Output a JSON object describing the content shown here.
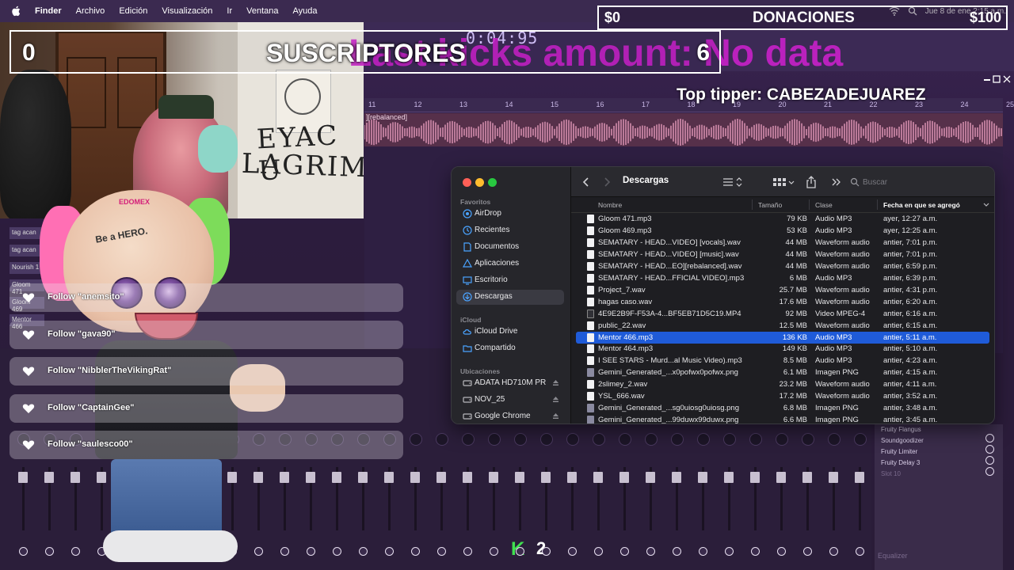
{
  "menubar": {
    "app": "Finder",
    "items": [
      "Archivo",
      "Edición",
      "Visualización",
      "Ir",
      "Ventana",
      "Ayuda"
    ],
    "clock": "Jue 8 de ene  2:15 a.m."
  },
  "daw": {
    "time": "0:04:95",
    "ruler": [
      "11",
      "12",
      "13",
      "14",
      "15",
      "16",
      "17",
      "18",
      "19",
      "20",
      "21",
      "22",
      "23",
      "24",
      "25"
    ],
    "clip_label": "][rebalanced]",
    "left_tags": [
      "tag acan",
      "tag acan",
      "Nourish 1",
      "Gloom 471",
      "Gloom 469",
      "Mentor 466"
    ],
    "fx_items": [
      "Fruity Flangus",
      "Soundgoodizer",
      "Fruity Limiter",
      "Fruity Delay 3",
      "Slot 10"
    ],
    "equalizer": "Equalizer",
    "k2_number": "2"
  },
  "webcam": {
    "graffiti_line1": "EYAC U",
    "graffiti_line2": "LAGRIMA"
  },
  "avatar": {
    "brand": "EDOMEX",
    "hero": "Be a HERO."
  },
  "subs": {
    "count": "0",
    "label": "SUSCRIPTORES",
    "goal": "6",
    "kicks_text": "Last kicks amount: No data"
  },
  "donations": {
    "min": "$0",
    "label": "DONACIONES",
    "max": "$100",
    "top_tipper": "Top tipper: CABEZADEJUAREZ"
  },
  "follows": [
    {
      "text": "Follow \"anemsito\""
    },
    {
      "text": "Follow \"gava90\""
    },
    {
      "text": "Follow \"NibblerTheVikingRat\""
    },
    {
      "text": "Follow \"CaptainGee\""
    },
    {
      "text": "Follow \"saulesco00\""
    }
  ],
  "finder": {
    "title": "Descargas",
    "search_placeholder": "Buscar",
    "sidebar": {
      "favorites_header": "Favoritos",
      "favorites": [
        {
          "label": "AirDrop",
          "icon": "airdrop-icon"
        },
        {
          "label": "Recientes",
          "icon": "clock-icon"
        },
        {
          "label": "Documentos",
          "icon": "document-icon"
        },
        {
          "label": "Aplicaciones",
          "icon": "applications-icon"
        },
        {
          "label": "Escritorio",
          "icon": "desktop-icon"
        },
        {
          "label": "Descargas",
          "icon": "download-icon"
        }
      ],
      "icloud_header": "iCloud",
      "icloud": [
        {
          "label": "iCloud Drive",
          "icon": "cloud-icon"
        },
        {
          "label": "Compartido",
          "icon": "shared-folder-icon"
        }
      ],
      "locations_header": "Ubicaciones",
      "locations": [
        {
          "label": "ADATA HD710M PR",
          "icon": "drive-icon"
        },
        {
          "label": "NOV_25",
          "icon": "drive-icon"
        },
        {
          "label": "Google Chrome",
          "icon": "drive-icon"
        }
      ]
    },
    "columns": {
      "name": "Nombre",
      "size": "Tamaño",
      "kind": "Clase",
      "date": "Fecha en que se agregó"
    },
    "files": [
      {
        "name": "Gloom 471.mp3",
        "size": "79 KB",
        "kind": "Audio MP3",
        "date": "ayer, 12:27 a.m.",
        "type": "doc"
      },
      {
        "name": "Gloom 469.mp3",
        "size": "53 KB",
        "kind": "Audio MP3",
        "date": "ayer, 12:25 a.m.",
        "type": "doc"
      },
      {
        "name": "SEMATARY - HEAD...VIDEO] [vocals].wav",
        "size": "44 MB",
        "kind": "Waveform audio",
        "date": "antier, 7:01 p.m.",
        "type": "doc"
      },
      {
        "name": "SEMATARY - HEAD...VIDEO] [music].wav",
        "size": "44 MB",
        "kind": "Waveform audio",
        "date": "antier, 7:01 p.m.",
        "type": "doc"
      },
      {
        "name": "SEMATARY - HEAD...EO][rebalanced].wav",
        "size": "44 MB",
        "kind": "Waveform audio",
        "date": "antier, 6:59 p.m.",
        "type": "doc"
      },
      {
        "name": "SEMATARY - HEAD...FFICIAL VIDEO].mp3",
        "size": "6 MB",
        "kind": "Audio MP3",
        "date": "antier, 6:39 p.m.",
        "type": "doc"
      },
      {
        "name": "Project_7.wav",
        "size": "25.7 MB",
        "kind": "Waveform audio",
        "date": "antier, 4:31 p.m.",
        "type": "doc"
      },
      {
        "name": "hagas caso.wav",
        "size": "17.6 MB",
        "kind": "Waveform audio",
        "date": "antier, 6:20 a.m.",
        "type": "doc"
      },
      {
        "name": "4E9E2B9F-F53A-4...BF5EB71D5C19.MP4",
        "size": "92 MB",
        "kind": "Video MPEG-4",
        "date": "antier, 6:16 a.m.",
        "type": "vid"
      },
      {
        "name": "public_22.wav",
        "size": "12.5 MB",
        "kind": "Waveform audio",
        "date": "antier, 6:15 a.m.",
        "type": "doc"
      },
      {
        "name": "Mentor 466.mp3",
        "size": "136 KB",
        "kind": "Audio MP3",
        "date": "antier, 5:11 a.m.",
        "type": "doc",
        "selected": true
      },
      {
        "name": "Mentor 464.mp3",
        "size": "149 KB",
        "kind": "Audio MP3",
        "date": "antier, 5:10 a.m.",
        "type": "doc"
      },
      {
        "name": "I SEE STARS - Murd...al Music Video).mp3",
        "size": "8.5 MB",
        "kind": "Audio MP3",
        "date": "antier, 4:23 a.m.",
        "type": "doc"
      },
      {
        "name": "Gemini_Generated_...x0pofwx0pofwx.png",
        "size": "6.1 MB",
        "kind": "Imagen PNG",
        "date": "antier, 4:15 a.m.",
        "type": "img"
      },
      {
        "name": "2slimey_2.wav",
        "size": "23.2 MB",
        "kind": "Waveform audio",
        "date": "antier, 4:11 a.m.",
        "type": "doc"
      },
      {
        "name": "YSL_666.wav",
        "size": "17.2 MB",
        "kind": "Waveform audio",
        "date": "antier, 3:52 a.m.",
        "type": "doc"
      },
      {
        "name": "Gemini_Generated_...sg0uiosg0uiosg.png",
        "size": "6.8 MB",
        "kind": "Imagen PNG",
        "date": "antier, 3:48 a.m.",
        "type": "img"
      },
      {
        "name": "Gemini_Generated_...99duwx99duwx.png",
        "size": "6.6 MB",
        "kind": "Imagen PNG",
        "date": "antier, 3:45 a.m.",
        "type": "img"
      }
    ]
  }
}
